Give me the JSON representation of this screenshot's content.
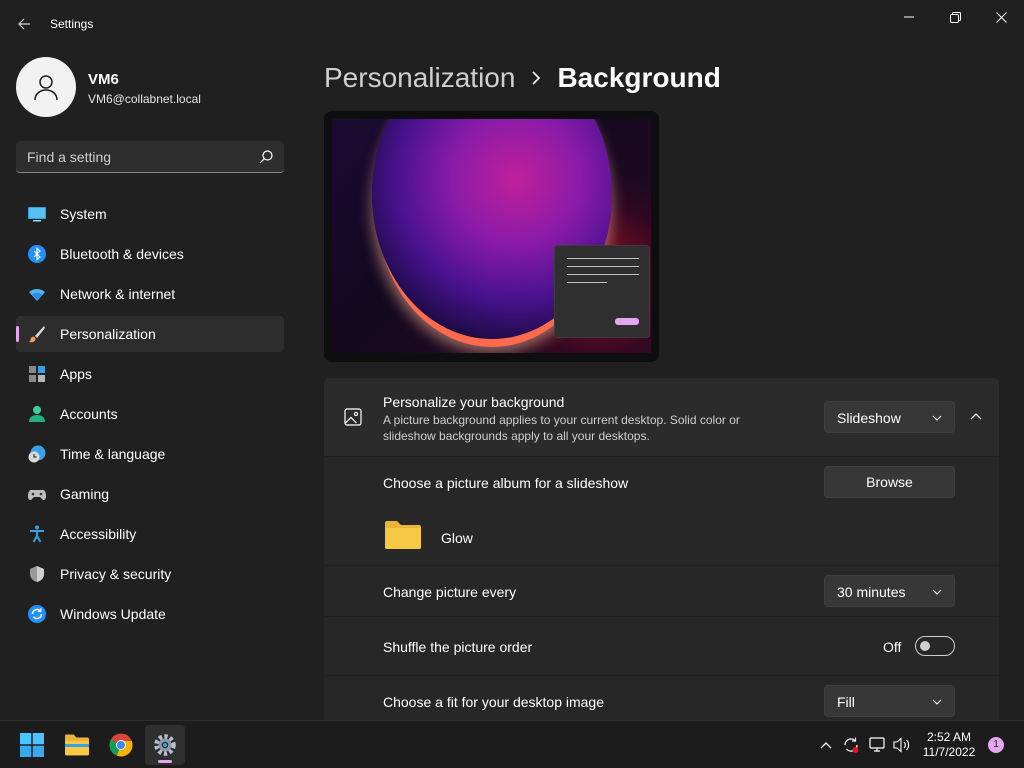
{
  "window": {
    "title": "Settings"
  },
  "user": {
    "name": "VM6",
    "email": "VM6@collabnet.local"
  },
  "search": {
    "placeholder": "Find a setting",
    "value": ""
  },
  "sidebar": {
    "items": [
      {
        "label": "System",
        "icon": "monitor-icon",
        "active": false
      },
      {
        "label": "Bluetooth & devices",
        "icon": "bluetooth-icon",
        "active": false
      },
      {
        "label": "Network & internet",
        "icon": "wifi-icon",
        "active": false
      },
      {
        "label": "Personalization",
        "icon": "paintbrush-icon",
        "active": true
      },
      {
        "label": "Apps",
        "icon": "apps-icon",
        "active": false
      },
      {
        "label": "Accounts",
        "icon": "person-icon",
        "active": false
      },
      {
        "label": "Time & language",
        "icon": "clock-globe-icon",
        "active": false
      },
      {
        "label": "Gaming",
        "icon": "gamepad-icon",
        "active": false
      },
      {
        "label": "Accessibility",
        "icon": "accessibility-icon",
        "active": false
      },
      {
        "label": "Privacy & security",
        "icon": "shield-icon",
        "active": false
      },
      {
        "label": "Windows Update",
        "icon": "update-icon",
        "active": false
      }
    ]
  },
  "breadcrumb": {
    "parent": "Personalization",
    "separator": "›",
    "current": "Background"
  },
  "settings": {
    "personalize": {
      "title": "Personalize your background",
      "description": "A picture background applies to your current desktop. Solid color or slideshow backgrounds apply to all your desktops.",
      "value": "Slideshow"
    },
    "album": {
      "title": "Choose a picture album for a slideshow",
      "browse_label": "Browse",
      "folder_name": "Glow"
    },
    "change": {
      "title": "Change picture every",
      "value": "30 minutes"
    },
    "shuffle": {
      "title": "Shuffle the picture order",
      "state_label": "Off",
      "on": false
    },
    "fit": {
      "title": "Choose a fit for your desktop image",
      "value": "Fill"
    }
  },
  "taskbar": {
    "apps": [
      "windows-start-icon",
      "file-explorer-icon",
      "chrome-icon",
      "settings-icon"
    ],
    "clock": {
      "time": "2:52 AM",
      "date": "11/7/2022"
    },
    "notification_count": "1"
  },
  "colors": {
    "accent": "#e3a6ef",
    "background": "#202020",
    "card": "#2b2b2b",
    "folder": "#f6c945"
  }
}
